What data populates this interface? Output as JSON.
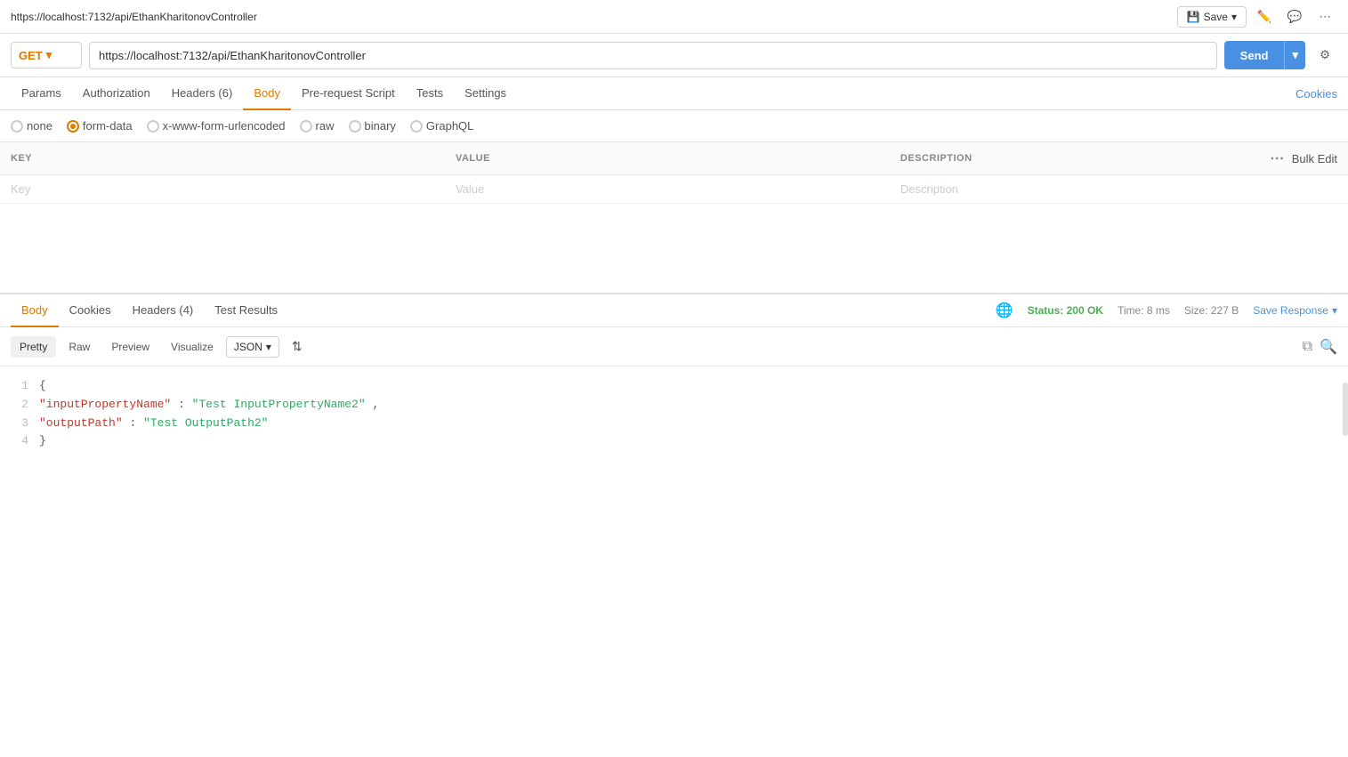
{
  "topbar": {
    "title": "https://localhost:7132/api/EthanKharitonovController",
    "save_label": "Save"
  },
  "urlbar": {
    "method": "GET",
    "url": "https://localhost:7132/api/EthanKharitonovController",
    "send_label": "Send"
  },
  "request_tabs": [
    {
      "id": "params",
      "label": "Params"
    },
    {
      "id": "authorization",
      "label": "Authorization"
    },
    {
      "id": "headers",
      "label": "Headers (6)"
    },
    {
      "id": "body",
      "label": "Body"
    },
    {
      "id": "prerequest",
      "label": "Pre-request Script"
    },
    {
      "id": "tests",
      "label": "Tests"
    },
    {
      "id": "settings",
      "label": "Settings"
    }
  ],
  "cookies_link": "Cookies",
  "body_types": [
    {
      "id": "none",
      "label": "none",
      "selected": false
    },
    {
      "id": "form-data",
      "label": "form-data",
      "selected": true
    },
    {
      "id": "x-www-form-urlencoded",
      "label": "x-www-form-urlencoded",
      "selected": false
    },
    {
      "id": "raw",
      "label": "raw",
      "selected": false
    },
    {
      "id": "binary",
      "label": "binary",
      "selected": false
    },
    {
      "id": "graphql",
      "label": "GraphQL",
      "selected": false
    }
  ],
  "form_table": {
    "columns": [
      "KEY",
      "VALUE",
      "DESCRIPTION"
    ],
    "rows": [],
    "placeholder_row": {
      "key": "Key",
      "value": "Value",
      "description": "Description"
    },
    "bulk_edit": "Bulk Edit"
  },
  "response": {
    "tabs": [
      {
        "id": "body",
        "label": "Body",
        "active": true
      },
      {
        "id": "cookies",
        "label": "Cookies"
      },
      {
        "id": "headers",
        "label": "Headers (4)"
      },
      {
        "id": "test-results",
        "label": "Test Results"
      }
    ],
    "status": "Status: 200 OK",
    "time": "Time: 8 ms",
    "size": "Size: 227 B",
    "save_response": "Save Response"
  },
  "format_bar": {
    "tabs": [
      {
        "id": "pretty",
        "label": "Pretty",
        "active": true
      },
      {
        "id": "raw",
        "label": "Raw"
      },
      {
        "id": "preview",
        "label": "Preview"
      },
      {
        "id": "visualize",
        "label": "Visualize"
      }
    ],
    "format": "JSON"
  },
  "code_lines": [
    {
      "num": "1",
      "content": "{"
    },
    {
      "num": "2",
      "key": "\"inputPropertyName\"",
      "colon": ": ",
      "value": "\"Test InputPropertyName2\"",
      "comma": ","
    },
    {
      "num": "3",
      "key": "\"outputPath\"",
      "colon": ": ",
      "value": "\"Test OutputPath2\""
    },
    {
      "num": "4",
      "content": "}"
    }
  ]
}
